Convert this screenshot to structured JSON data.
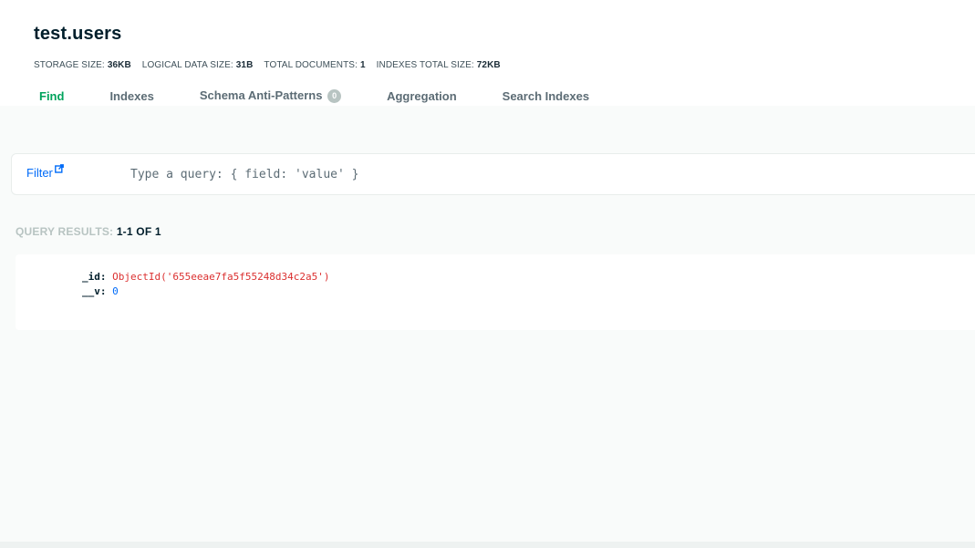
{
  "collection": {
    "title": "test.users",
    "stats": [
      {
        "label": "STORAGE SIZE:",
        "value": "36KB"
      },
      {
        "label": "LOGICAL DATA SIZE:",
        "value": "31B"
      },
      {
        "label": "TOTAL DOCUMENTS:",
        "value": "1"
      },
      {
        "label": "INDEXES TOTAL SIZE:",
        "value": "72KB"
      }
    ]
  },
  "tabs": [
    {
      "label": "Find",
      "active": true
    },
    {
      "label": "Indexes"
    },
    {
      "label": "Schema Anti-Patterns",
      "badge": "0"
    },
    {
      "label": "Aggregation"
    },
    {
      "label": "Search Indexes"
    }
  ],
  "filter": {
    "label": "Filter",
    "placeholder": "Type a query: { field: 'value' }"
  },
  "results": {
    "label": "QUERY RESULTS:",
    "count": "1-1 OF 1"
  },
  "document": {
    "fields": [
      {
        "key": "_id:",
        "value": "ObjectId('655eeae7fa5f55248d34c2a5')",
        "kind": "oid"
      },
      {
        "key": "__v:",
        "value": "0",
        "kind": "num"
      }
    ]
  },
  "icons": {
    "filter_link": "external-link-icon"
  },
  "colors": {
    "accent_green": "#00a35c",
    "link_blue": "#016bf8",
    "oid_red": "#db3030"
  }
}
